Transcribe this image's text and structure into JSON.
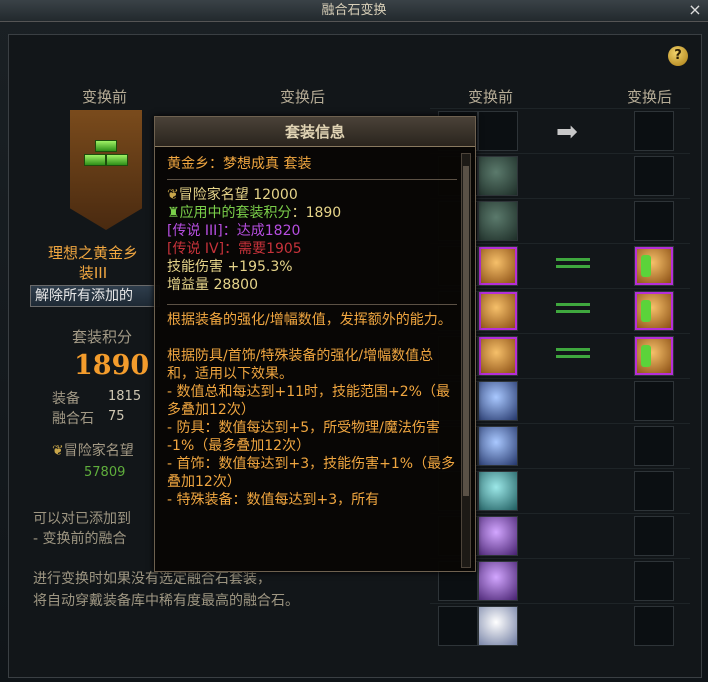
{
  "window": {
    "title": "融合石变换",
    "close_label": "×",
    "help_label": "?"
  },
  "left": {
    "header_before": "变换前",
    "header_after": "变换后",
    "set_name_line1": "理想之黄金乡",
    "set_name_line2": "装III",
    "remove_button": "解除所有添加的",
    "set_score_label": "套装积分",
    "set_score_value": "1890",
    "equip_label": "装备",
    "equip_value": "1815",
    "fusion_label": "融合石",
    "fusion_value": "75",
    "adventurer_label": "冒险家名望",
    "adventurer_value": "57809",
    "note1": "可以对已添加到",
    "note2": "- 变换前的融合",
    "note3": "进行变换时如果没有选定融合石套装，",
    "note4": "将自动穿戴装备库中稀有度最高的融合石。"
  },
  "grid": {
    "header_before": "变换前",
    "header_after": "变换后",
    "arrow": "➡",
    "rows": [
      {
        "before": "empty",
        "after": "empty",
        "mark": "arrow"
      },
      {
        "before": "dark-green",
        "after": "empty",
        "mark": "none"
      },
      {
        "before": "dark-green",
        "after": "empty",
        "mark": "none"
      },
      {
        "before": "gold-armor",
        "after": "gold-armor-green",
        "mark": "equal"
      },
      {
        "before": "gold-armor",
        "after": "gold-armor-green",
        "mark": "equal"
      },
      {
        "before": "gold-armor",
        "after": "gold-armor-green",
        "mark": "equal"
      },
      {
        "before": "blue-orb",
        "after": "empty",
        "mark": "none"
      },
      {
        "before": "blue-orb",
        "after": "empty",
        "mark": "none"
      },
      {
        "before": "teal-orb",
        "after": "empty",
        "mark": "none"
      },
      {
        "before": "purple-orb",
        "after": "empty",
        "mark": "none"
      },
      {
        "before": "purple-orb",
        "after": "empty",
        "mark": "none"
      },
      {
        "before": "white-orb",
        "after": "empty",
        "mark": "none"
      }
    ]
  },
  "colors": {
    "accent_orange": "#f39c2c",
    "green": "#3fa83e",
    "gold": "#d4a03a"
  },
  "tooltip": {
    "title": "套装信息",
    "set_line": "黄金乡：梦想成真  套装",
    "adv_label": "冒险家名望",
    "adv_value": "12000",
    "applied_label": "应用中的套装积分",
    "applied_value": "1890",
    "legend3": "[传说 III]：达成1820",
    "legend4": "[传说 IV]：需要1905",
    "skill_damage": "技能伤害 +195.3%",
    "boost": "增益量 28800",
    "desc1": "根据装备的强化/增幅数值，发挥额外的能力。",
    "desc2": "根据防具/首饰/特殊装备的强化/增幅数值总和，适用以下效果。",
    "desc3": "- 数值总和每达到+11时，技能范围+2%（最多叠加12次）",
    "desc4": "- 防具：数值每达到+5，所受物理/魔法伤害 -1%（最多叠加12次）",
    "desc5": "- 首饰：数值每达到+3，技能伤害+1%（最多叠加12次）",
    "desc6": "- 特殊装备：数值每达到+3，所有"
  }
}
